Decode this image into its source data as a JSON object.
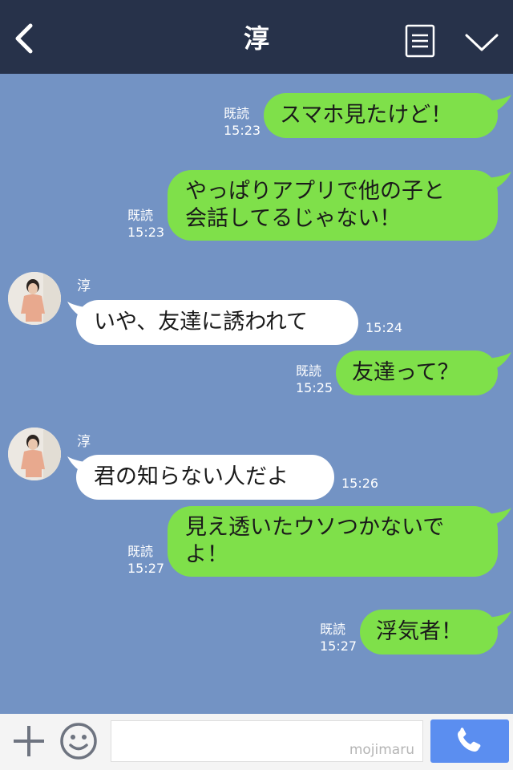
{
  "header": {
    "title": "淳"
  },
  "messages": [
    {
      "text": "スマホ見たけど！",
      "read": "既読",
      "time": "15:23"
    },
    {
      "line1": "やっぱりアプリで他の子と",
      "line2": "会話してるじゃない！",
      "read": "既読",
      "time": "15:23"
    },
    {
      "sender": "淳",
      "text": "いや、友達に誘われて",
      "time": "15:24"
    },
    {
      "text": "友達って？",
      "read": "既読",
      "time": "15:25"
    },
    {
      "sender": "淳",
      "text": "君の知らない人だよ",
      "time": "15:26"
    },
    {
      "line1": "見え透いたウソつかないで",
      "line2": "よ！",
      "read": "既読",
      "time": "15:27"
    },
    {
      "text": "浮気者！",
      "read": "既読",
      "time": "15:27"
    }
  ],
  "input": {
    "value": "",
    "watermark": "mojimaru"
  },
  "icons": {
    "back": "chevron-left-icon",
    "menu": "menu-icon",
    "chevron": "chevron-down-icon",
    "plus": "plus-icon",
    "emoji": "smiley-icon",
    "call": "phone-icon"
  },
  "colors": {
    "header": "#27324a",
    "background": "#7393c4",
    "sent_bubble": "#7fe04a",
    "received_bubble": "#ffffff",
    "call_button": "#5b8ef0"
  }
}
